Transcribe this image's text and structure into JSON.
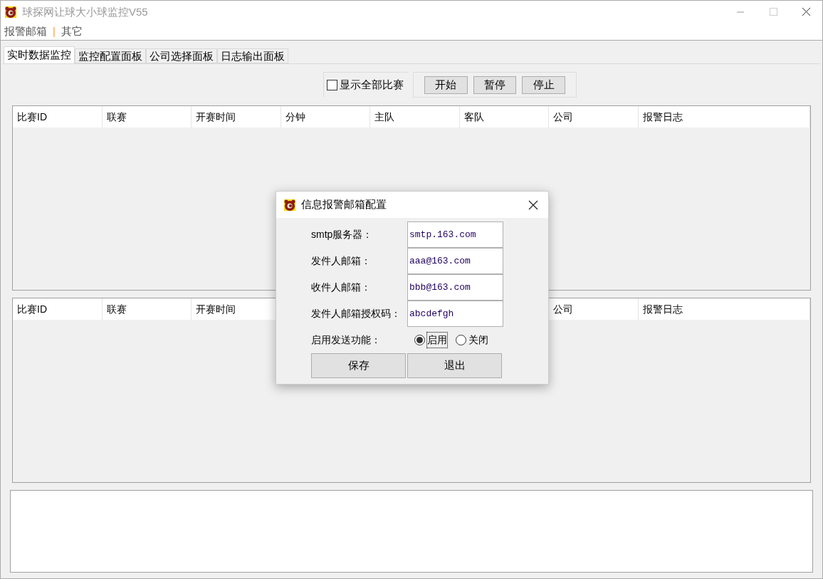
{
  "window": {
    "title": "球探网让球大小球监控V55",
    "active": false
  },
  "menu": [
    {
      "label": "报警邮箱"
    },
    {
      "label": "其它"
    }
  ],
  "menu_separator": "|",
  "tabs": [
    {
      "label": "实时数据监控",
      "selected": true
    },
    {
      "label": "监控配置面板",
      "selected": false
    },
    {
      "label": "公司选择面板",
      "selected": false
    },
    {
      "label": "日志输出面板",
      "selected": false
    }
  ],
  "show_all": {
    "label": "显示全部比赛",
    "checked": false
  },
  "buttons": [
    "开始",
    "暂停",
    "停止"
  ],
  "table_top": {
    "columns": [
      "比赛ID",
      "联赛",
      "开赛时间",
      "分钟",
      "主队",
      "客队",
      "公司",
      "报警日志"
    ]
  },
  "table_bottom": {
    "columns": [
      "比赛ID",
      "联赛",
      "开赛时间",
      null,
      null,
      null,
      "公司",
      "报警日志"
    ]
  },
  "dialog": {
    "title": "信息报警邮箱配置",
    "fields": [
      {
        "label": "smtp服务器：",
        "value": "smtp.163.com"
      },
      {
        "label": "发件人邮箱：",
        "value": "aaa@163.com"
      },
      {
        "label": "收件人邮箱：",
        "value": "bbb@163.com"
      },
      {
        "label": "发件人邮箱授权码：",
        "value": "abcdefgh"
      }
    ],
    "send": {
      "label": "启用发送功能：",
      "options": [
        {
          "label": "启用",
          "selected": true,
          "focused": true
        },
        {
          "label": "关闭",
          "selected": false,
          "focused": false
        }
      ]
    },
    "buttons": [
      "保存",
      "退出"
    ]
  }
}
